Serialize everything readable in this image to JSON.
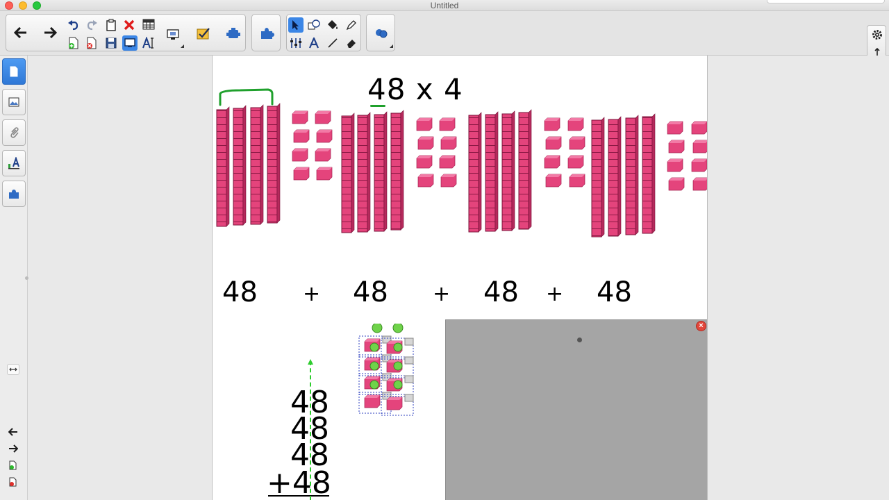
{
  "window": {
    "title": "Untitled"
  },
  "toolbar": {
    "back": "back-arrow-icon",
    "forward": "forward-arrow-icon"
  },
  "canvas": {
    "equation": "48 x 4",
    "addends": [
      "48",
      "48",
      "48",
      "48"
    ],
    "plus_sign": "+",
    "vertical_addition": [
      "48",
      "48",
      "48",
      "+48"
    ],
    "close_symbol": "×"
  },
  "colors": {
    "blocks": "#e4447c",
    "bracket": "#1fa02c",
    "guide": "#2ecc2e",
    "panel": "#a5a5a5",
    "selection": "#2c3fbf"
  }
}
